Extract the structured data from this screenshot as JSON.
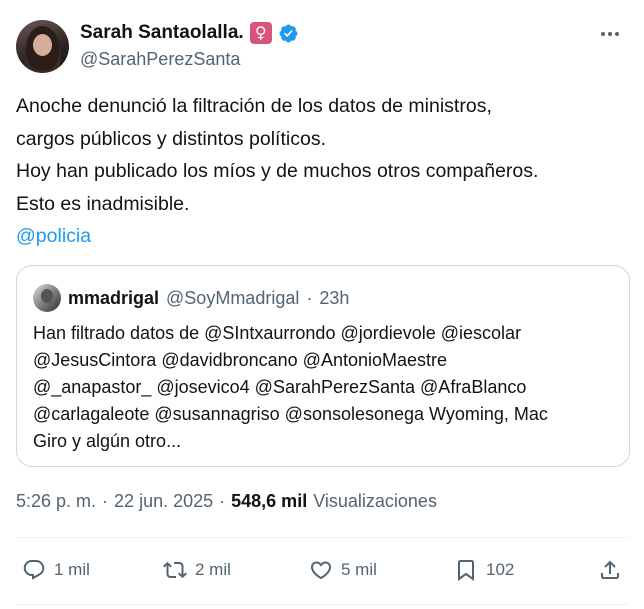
{
  "author": {
    "display_name": "Sarah Santaolalla.",
    "badge_symbol": "♀",
    "handle": "@SarahPerezSanta"
  },
  "tweet": {
    "lines": [
      "Anoche denunció la filtración de los datos de ministros,",
      "cargos públicos y distintos políticos.",
      "Hoy han publicado los míos y de muchos otros compañeros.",
      "Esto es inadmisible."
    ],
    "mention": "@policia"
  },
  "quote": {
    "name": "mmadrigal",
    "handle": "@SoyMmadrigal",
    "separator": "·",
    "time": "23h",
    "lines": [
      "Han filtrado datos de @SIntxaurrondo @jordievole @iescolar",
      "@JesusCintora @davidbroncano @AntonioMaestre",
      "@_anapastor_ @josevico4 @SarahPerezSanta @AfraBlanco",
      "@carlagaleote @susannagriso @sonsolesonega Wyoming, Mac",
      "Giro y algún otro..."
    ]
  },
  "meta": {
    "time": "5:26 p. m.",
    "sep1": "·",
    "date": "22 jun. 2025",
    "sep2": "·",
    "views_count": "548,6 mil",
    "views_label": "Visualizaciones"
  },
  "actions": {
    "reply_count": "1 mil",
    "retweet_count": "2 mil",
    "like_count": "5 mil",
    "bookmark_count": "102"
  },
  "colors": {
    "accent": "#1d9bf0",
    "muted": "#536471",
    "text": "#0f1419",
    "female_badge": "#d9547a"
  }
}
